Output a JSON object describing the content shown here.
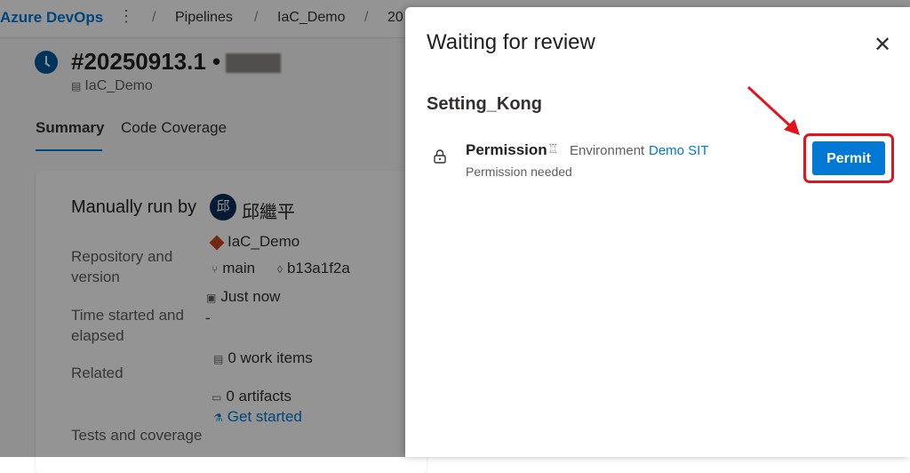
{
  "app": {
    "brand": "Azure DevOps",
    "more": "⋮"
  },
  "breadcrumb": [
    "Pipelines",
    "IaC_Demo",
    "20"
  ],
  "breadcrumb_sep": "/",
  "run": {
    "number": "#20250913.1 •",
    "pipeline": "IaC_Demo"
  },
  "tabs": [
    "Summary",
    "Code Coverage"
  ],
  "summary": {
    "manually_run_by": "Manually run by",
    "avatar_char": "邱",
    "user": "邱繼平",
    "repo_label": "Repository and version",
    "repo": "IaC_Demo",
    "branch": "main",
    "commit": "b13a1f2a",
    "time_label": "Time started and elapsed",
    "time_started": "Just now",
    "elapsed": "-",
    "related_label": "Related",
    "work_items": "0 work items",
    "artifacts": "0 artifacts",
    "tests_label": "Tests and coverage",
    "get_started": "Get started"
  },
  "panel": {
    "title": "Waiting for review",
    "close": "✕",
    "stage": "Setting_Kong",
    "check": {
      "title": "Permission",
      "env_label": "Environment",
      "env_name": "Demo SIT",
      "status": "Permission needed",
      "action": "Permit"
    }
  },
  "colors": {
    "accent": "#0078d4",
    "highlight": "#e0141e"
  }
}
